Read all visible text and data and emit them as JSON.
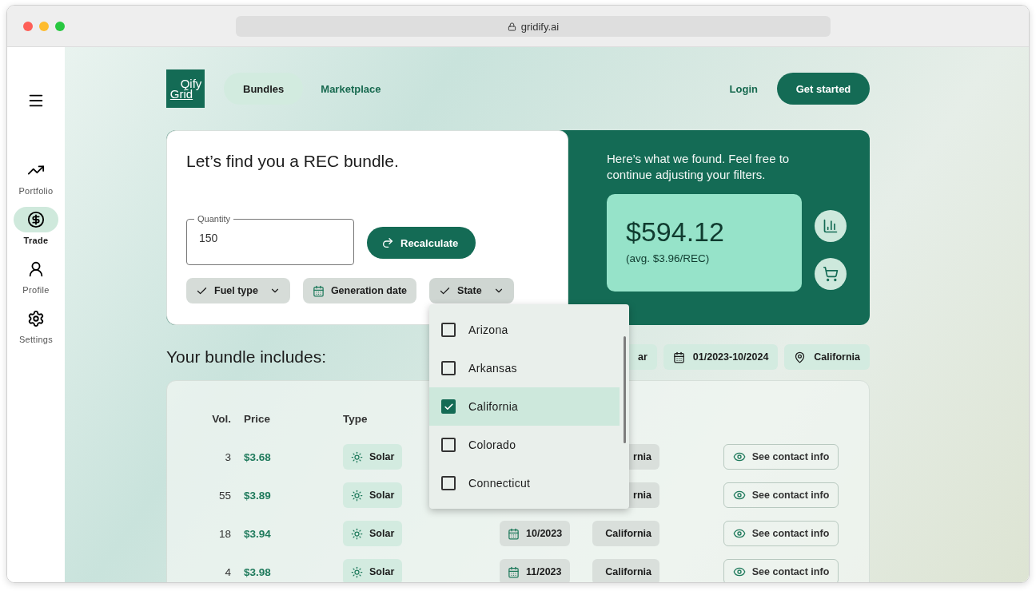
{
  "browser": {
    "url": "gridify.ai"
  },
  "sidebar": {
    "items": [
      {
        "label": "Portfolio",
        "kind": "portfolio",
        "selected": false
      },
      {
        "label": "Trade",
        "kind": "trade",
        "selected": true
      },
      {
        "label": "Profile",
        "kind": "profile",
        "selected": false
      },
      {
        "label": "Settings",
        "kind": "settings",
        "selected": false
      }
    ]
  },
  "nav": {
    "logo": {
      "top": "Qify",
      "bottom": "Grid"
    },
    "links": [
      {
        "label": "Bundles",
        "selected": true
      },
      {
        "label": "Marketplace",
        "selected": false
      }
    ],
    "login": "Login",
    "cta": "Get started"
  },
  "search": {
    "title": "Let’s find you a REC bundle.",
    "quantity": {
      "label": "Quantity",
      "value": "150"
    },
    "recalculate": "Recalculate",
    "filters": [
      {
        "label": "Fuel type",
        "kind": "select"
      },
      {
        "label": "Generation date",
        "kind": "date"
      },
      {
        "label": "State",
        "kind": "select",
        "open": true
      }
    ]
  },
  "dropdown": {
    "options": [
      {
        "label": "Arizona",
        "checked": false
      },
      {
        "label": "Arkansas",
        "checked": false
      },
      {
        "label": "California",
        "checked": true
      },
      {
        "label": "Colorado",
        "checked": false
      },
      {
        "label": "Connecticut",
        "checked": false
      }
    ]
  },
  "result": {
    "message": "Here’s what we found. Feel free to continue adjusting your filters.",
    "total": "$594.12",
    "average": "(avg. $3.96/REC)"
  },
  "bundle": {
    "title": "Your bundle includes:",
    "chips": [
      {
        "label": "ar",
        "kind": "plain"
      },
      {
        "label": "01/2023-10/2024",
        "kind": "date"
      },
      {
        "label": "California",
        "kind": "location"
      }
    ]
  },
  "table": {
    "columns": [
      "Vol.",
      "Price",
      "Type"
    ],
    "rows": [
      {
        "vol": "3",
        "price": "$3.68",
        "type": "Solar",
        "state": "rnia",
        "action": "See contact info"
      },
      {
        "vol": "55",
        "price": "$3.89",
        "type": "Solar",
        "state": "rnia",
        "action": "See contact info"
      },
      {
        "vol": "18",
        "price": "$3.94",
        "type": "Solar",
        "date": "10/2023",
        "state": "California",
        "action": "See contact info"
      },
      {
        "vol": "4",
        "price": "$3.98",
        "type": "Solar",
        "date": "11/2023",
        "state": "California",
        "action": "See contact info"
      }
    ]
  }
}
